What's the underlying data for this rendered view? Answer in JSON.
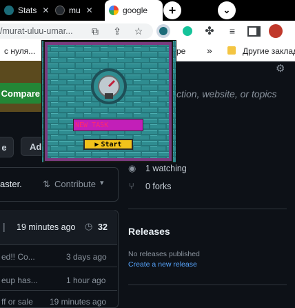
{
  "tabs": [
    {
      "label": "Stats"
    },
    {
      "label": "mu"
    },
    {
      "label": "google"
    }
  ],
  "toolbar": {
    "url": "/murat-uluu-umar..."
  },
  "bookmarks": {
    "item1": "с нуля...",
    "item2": "ре",
    "overflow": "»",
    "folder": "Другие заклад"
  },
  "github": {
    "compare_button": "Compare",
    "search_placeholder": "ction, website, or topics",
    "e_btn": "e",
    "ad_btn": "Ad",
    "branch_text": "aster.",
    "contribute_label": "Contribute",
    "commit_time": "19 minutes ago",
    "commit_count": "32",
    "files": [
      {
        "name": "ed!! Co...",
        "time": "3 days ago"
      },
      {
        "name": "eup has...",
        "time": "1 hour ago"
      },
      {
        "name": "ff or sale",
        "time": "19 minutes ago"
      }
    ],
    "watching": "1 watching",
    "forks": "0 forks",
    "releases_title": "Releases",
    "no_releases": "No releases published",
    "create_release": "Create a new release"
  },
  "popup": {
    "title_field": "NEW TASK",
    "start_button": "Start"
  },
  "colors": {
    "page_bg": "#0d1117",
    "compare_green": "#238636",
    "link_blue": "#58a6ff",
    "popup_brick": "#2a7a7c",
    "popup_frame": "#7a3b7f",
    "field_magenta": "#c21fb8",
    "start_gold": "#f2c21b"
  }
}
